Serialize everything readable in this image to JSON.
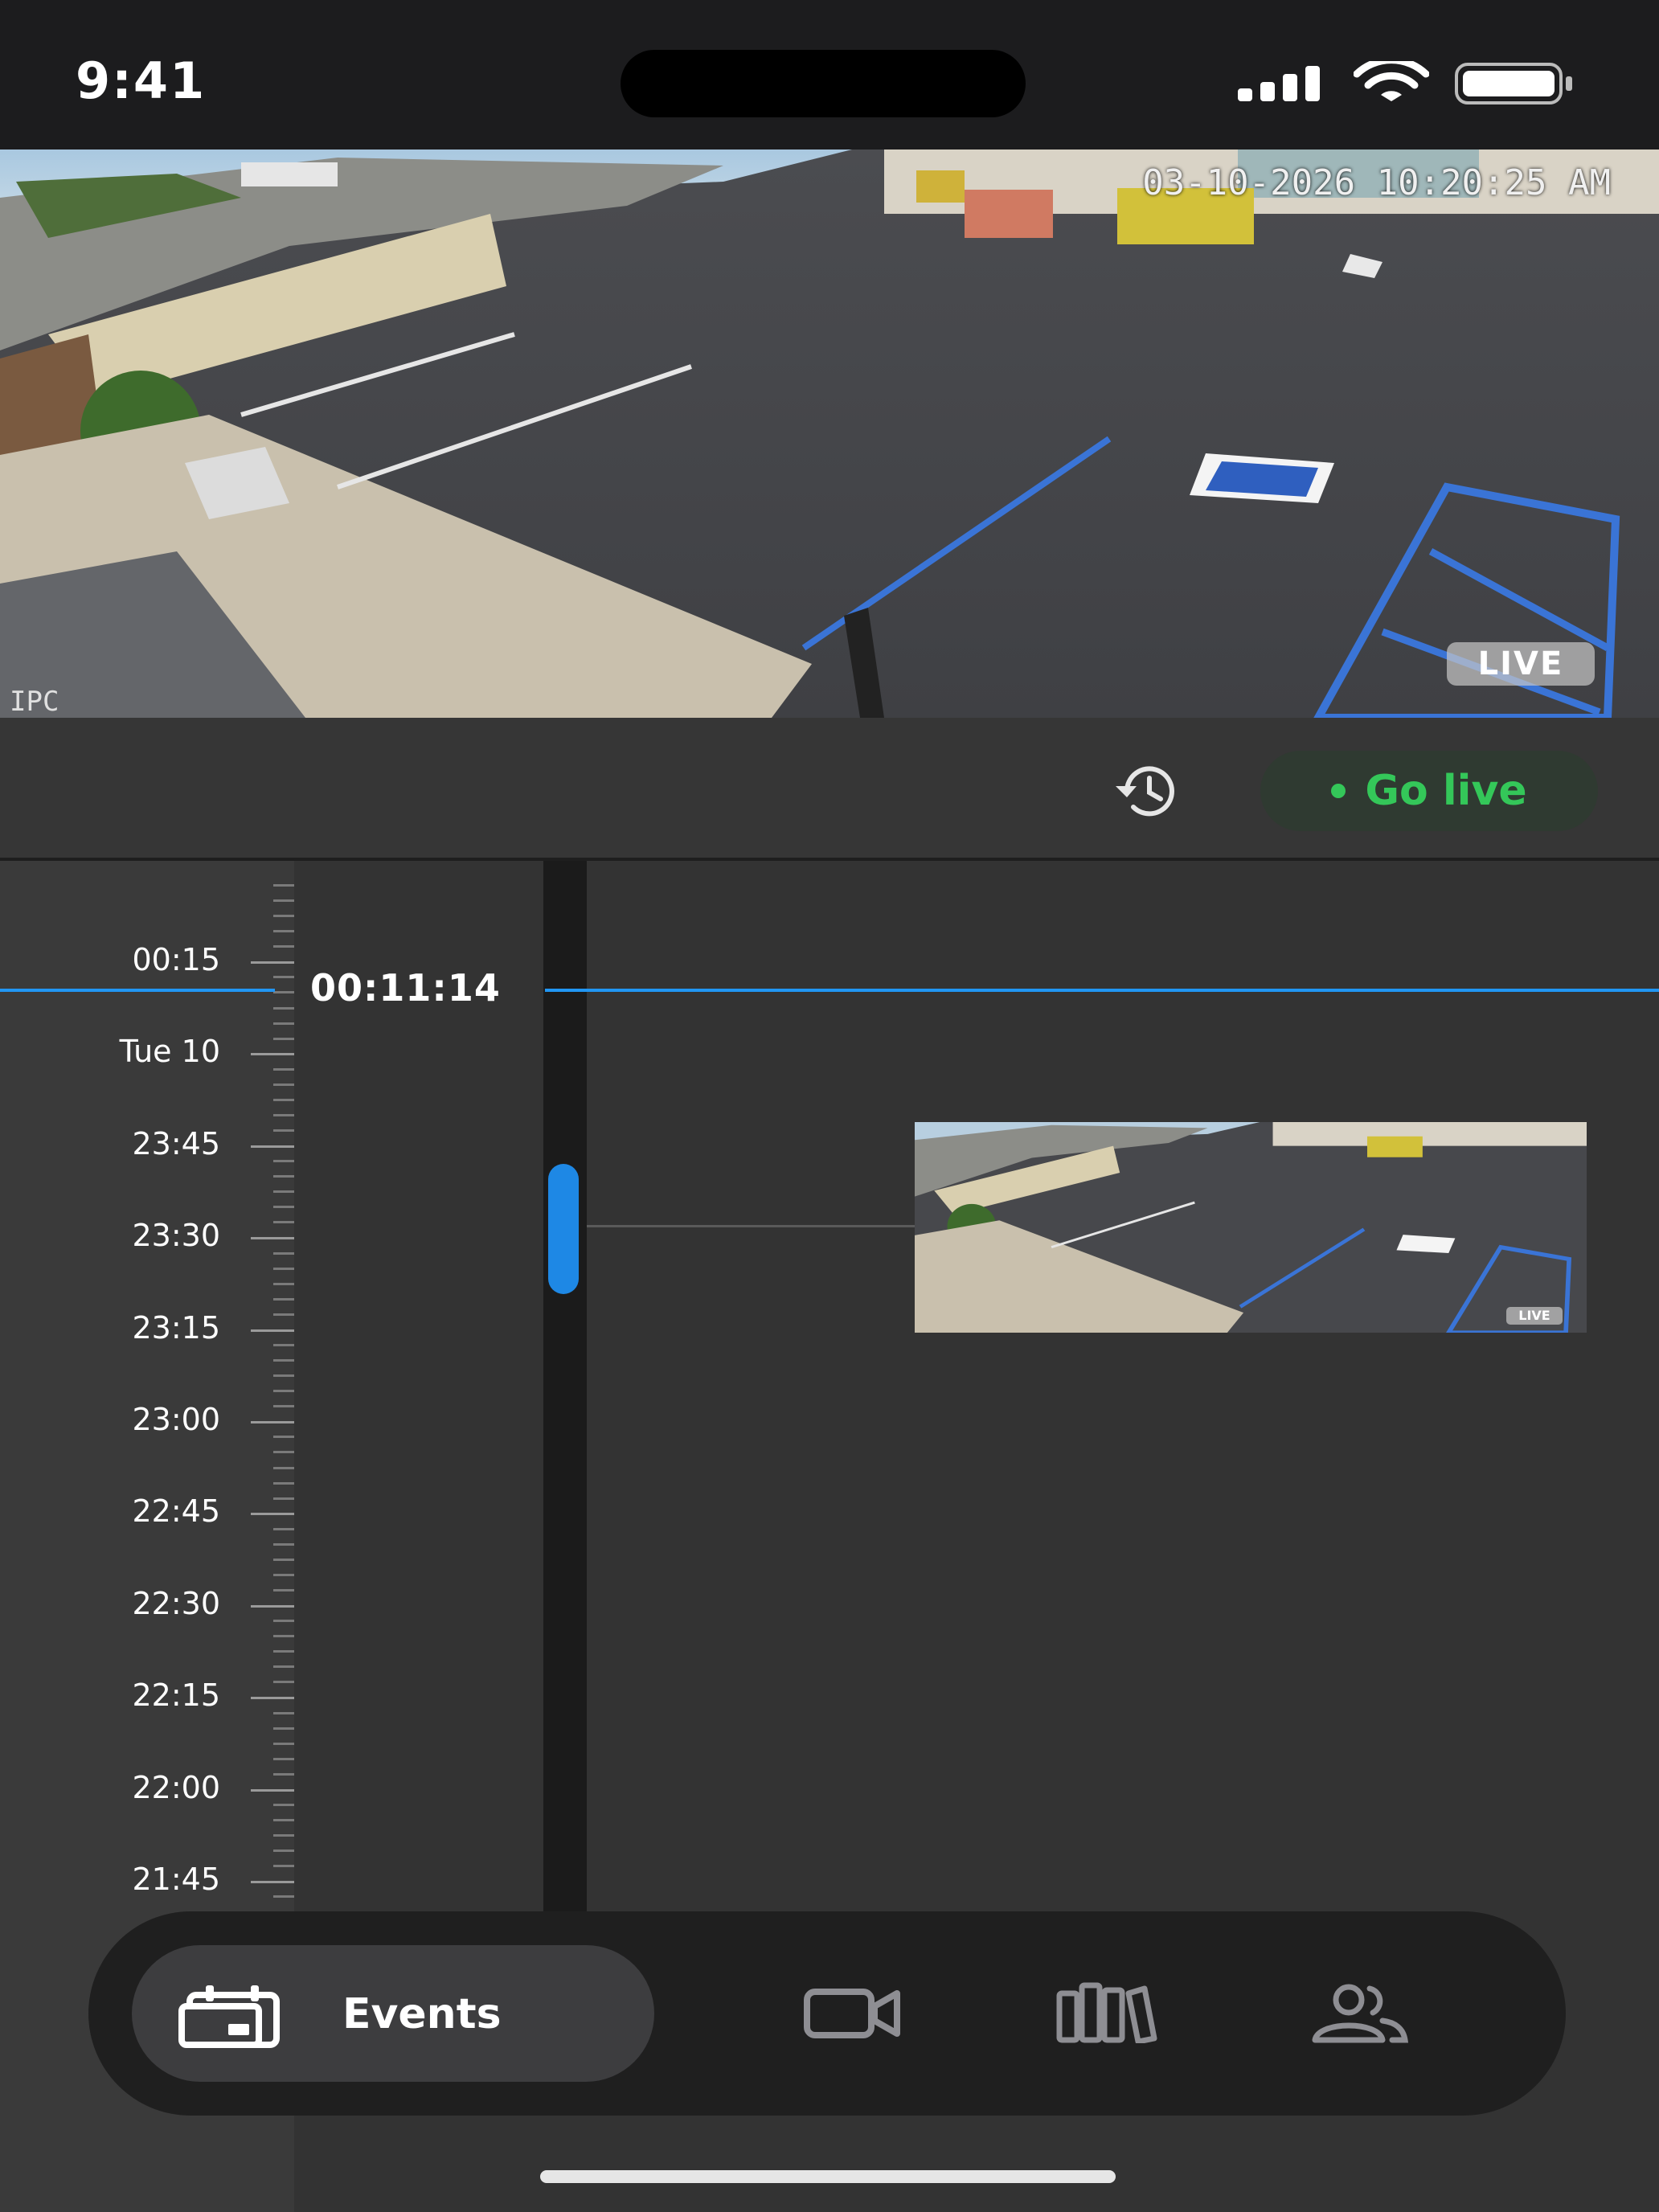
{
  "status_bar": {
    "time": "9:41"
  },
  "camera_feed": {
    "timestamp": "03-10-2026 10:20:25 AM",
    "watermark": "IPC",
    "live_badge": "LIVE"
  },
  "controls": {
    "history_icon": "history-icon",
    "go_live_label": "Go live",
    "accent_color": "#34c759"
  },
  "timeline": {
    "current_time": "00:11:14",
    "ticks": [
      "00:15",
      "Tue 10",
      "23:45",
      "23:30",
      "23:15",
      "23:00",
      "22:45",
      "22:30",
      "22:15",
      "22:00",
      "21:45"
    ],
    "event_thumbnail_badge": "LIVE",
    "accent_color": "#2196f3"
  },
  "tab_bar": {
    "events_label": "Events",
    "tabs": [
      {
        "name": "events",
        "icon": "events-icon",
        "label": "Events",
        "selected": true
      },
      {
        "name": "cameras",
        "icon": "camera-icon",
        "selected": false
      },
      {
        "name": "library",
        "icon": "library-icon",
        "selected": false
      },
      {
        "name": "people",
        "icon": "people-icon",
        "selected": false
      }
    ]
  }
}
